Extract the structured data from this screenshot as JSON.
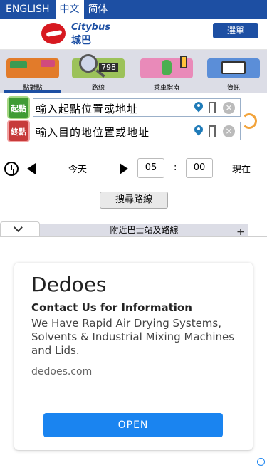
{
  "lang_bar": {
    "english": "ENGLISH",
    "trad_chinese": "中文",
    "simp_chinese": "简体"
  },
  "header": {
    "logo_en": "Citybus",
    "logo_zh": "城巴",
    "menu_label": "選單"
  },
  "tabs": [
    {
      "label": "點對點",
      "icon": "route-planner-icon"
    },
    {
      "label": "路線",
      "icon": "route-search-icon"
    },
    {
      "label": "乘車指南",
      "icon": "walking-guide-icon"
    },
    {
      "label": "資訊",
      "icon": "info-book-icon"
    }
  ],
  "route": {
    "start_badge": "起點",
    "end_badge": "終點",
    "start_value": "輸入起點位置或地址",
    "end_value": "輸入目的地位置或地址"
  },
  "time": {
    "day_label": "今天",
    "hour": "05",
    "minute": "00",
    "now_label": "現在"
  },
  "search_label": "搜尋路線",
  "panel": {
    "title": "附近巴士站及路線",
    "plus": "+"
  },
  "ad": {
    "title": "Dedoes",
    "subtitle": "Contact Us for Information",
    "description": "We Have Rapid Air Drying Systems, Solvents & Industrial Mixing Machines and Lids.",
    "url": "dedoes.com",
    "cta": "OPEN",
    "info": "i"
  },
  "colors": {
    "brand": "#1d4fa3",
    "start": "#3f9c35",
    "end": "#c73a3a",
    "cta": "#1a84f0"
  }
}
